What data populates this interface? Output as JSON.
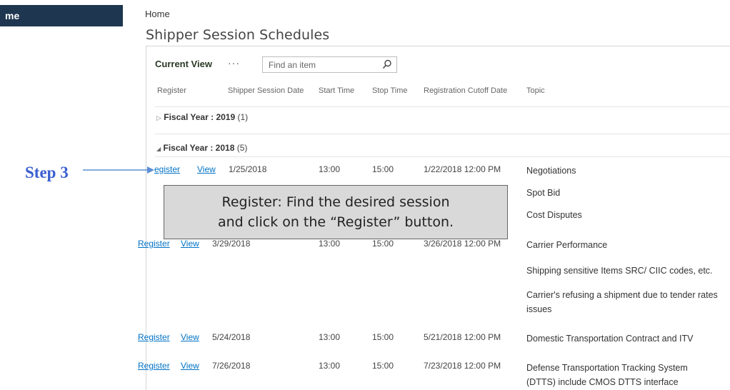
{
  "nav": {
    "home_label": "me"
  },
  "breadcrumb": "Home",
  "page_title": "Shipper Session Schedules",
  "toolbar": {
    "current_view_label": "Current View",
    "more_label": "···",
    "search_placeholder": "Find an item"
  },
  "columns": [
    "Register",
    "Shipper Session Date",
    "Start Time",
    "Stop Time",
    "Registration Cutoff Date",
    "Topic"
  ],
  "groups": [
    {
      "prefix": "Fiscal Year : ",
      "year": "2019",
      "count": "(1)",
      "expanded": false
    },
    {
      "prefix": "Fiscal Year : ",
      "year": "2018",
      "count": "(5)",
      "expanded": true
    }
  ],
  "rows": [
    {
      "register_label": "egister",
      "view_label": "View",
      "date": "1/25/2018",
      "start": "13:00",
      "stop": "15:00",
      "cutoff": "1/22/2018 12:00 PM",
      "topics": [
        "Negotiations",
        "Spot Bid",
        "Cost Disputes"
      ]
    },
    {
      "register_label": "Register",
      "view_label": "View",
      "date": "3/29/2018",
      "start": "13:00",
      "stop": "15:00",
      "cutoff": "3/26/2018 12:00 PM",
      "topics": [
        "Carrier Performance",
        "Shipping sensitive Items SRC/ CIIC codes, etc.",
        "Carrier's refusing a shipment due to tender rates issues"
      ]
    },
    {
      "register_label": "Register",
      "view_label": "View",
      "date": "5/24/2018",
      "start": "13:00",
      "stop": "15:00",
      "cutoff": "5/21/2018 12:00 PM",
      "topics": [
        "Domestic Transportation Contract and ITV"
      ]
    },
    {
      "register_label": "Register",
      "view_label": "View",
      "date": "7/26/2018",
      "start": "13:00",
      "stop": "15:00",
      "cutoff": "7/23/2018 12:00 PM",
      "topics": [
        "Defense Transportation Tracking System (DTTS) include CMOS DTTS interface"
      ]
    }
  ],
  "annotation": {
    "step_label": "Step 3",
    "callout_line1": "Register: Find the desired session",
    "callout_line2": "and click on the “Register” button.",
    "arrow_color": "#5b8ed6"
  }
}
